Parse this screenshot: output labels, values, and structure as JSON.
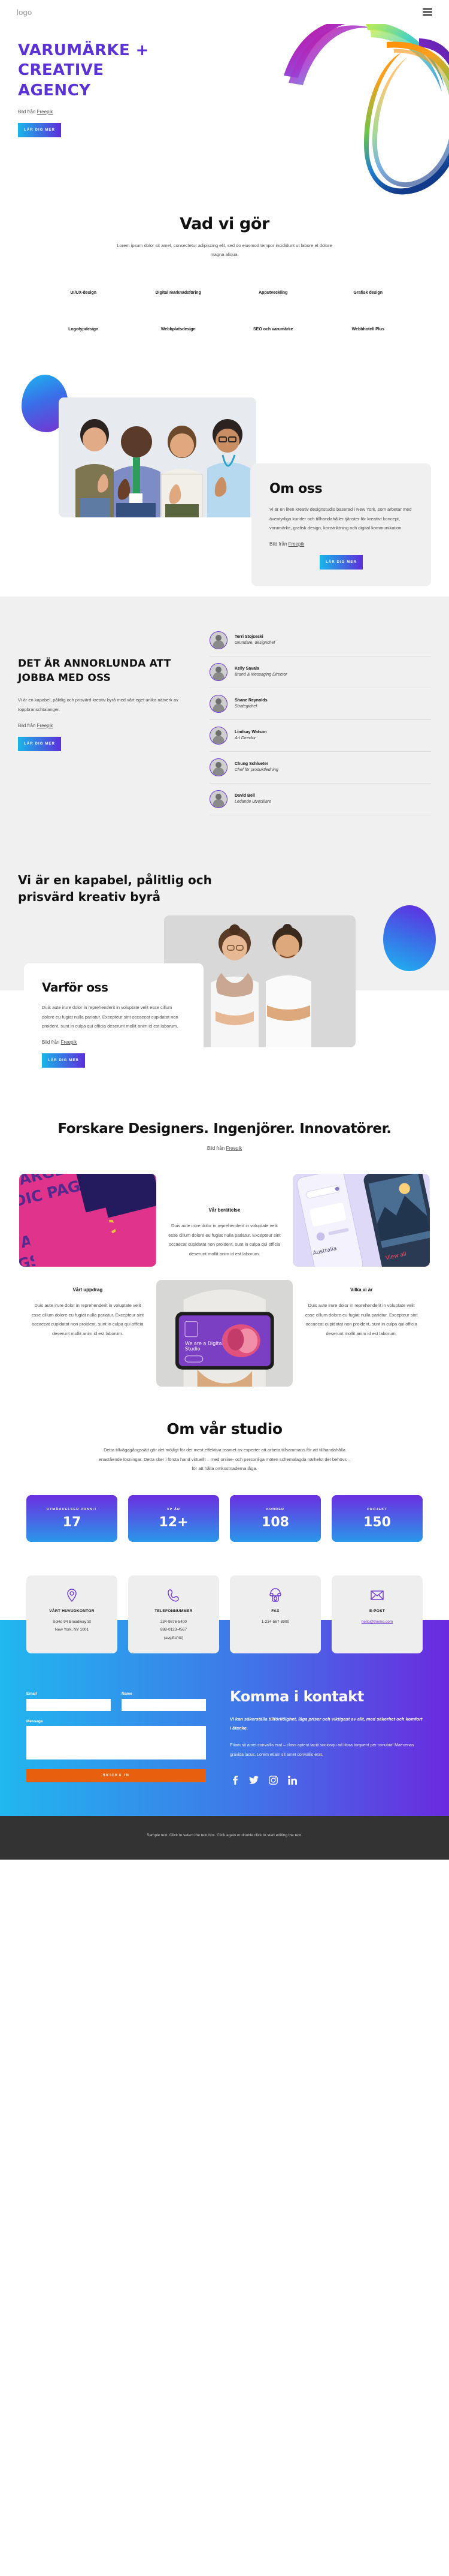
{
  "header": {
    "logo": "logo",
    "menu_icon": "hamburger-icon"
  },
  "hero": {
    "title": "VARUMÄRKE + CREATIVE AGENCY",
    "credit_prefix": "Bild från ",
    "credit_link": "Freepik",
    "cta": "LÄR DIG MER"
  },
  "services": {
    "heading": "Vad vi gör",
    "lead": "Lorem ipsum dolor sit amet, consectetur adipiscing elit, sed do eiusmod tempor incididunt ut labore et dolore magna aliqua.",
    "items": [
      "UI/UX-design",
      "Digital marknadsföring",
      "Apputveckling",
      "Grafisk design",
      "Logotypdesign",
      "Webbplatsdesign",
      "SEO och varumärke",
      "Webbhotell Plus"
    ]
  },
  "about": {
    "heading": "Om oss",
    "body": "Vi är en liten kreativ designstudio baserad i New York, som arbetar med äventyrliga kunder och tillhandahåller tjänster för kreativt koncept, varumärke, grafisk design, konstriktning och digital kommunikation.",
    "credit_prefix": "Bild från ",
    "credit_link": "Freepik",
    "cta": "LÄR DIG MER"
  },
  "team": {
    "heading": "DET ÄR ANNORLUNDA ATT JOBBA MED OSS",
    "body": "Vi är en kapabel, pålitlig och prisvärd kreativ byrå med vårt eget unika nätverk av toppbranschtalanger.",
    "credit_prefix": "Bild från ",
    "credit_link": "Freepik",
    "cta": "LÄR DIG MER",
    "members": [
      {
        "name": "Terri Stojceski",
        "role": "Grundare, designchef"
      },
      {
        "name": "Kelly Savala",
        "role": "Brand & Messaging Director"
      },
      {
        "name": "Shane Reynolds",
        "role": "Strategichef"
      },
      {
        "name": "Lindsay Watson",
        "role": "Art Director"
      },
      {
        "name": "Chung Schlueter",
        "role": "Chef för produktledning"
      },
      {
        "name": "David Bell",
        "role": "Ledande utvecklare"
      }
    ]
  },
  "why": {
    "headline": "Vi är en kapabel, pålitlig och prisvärd kreativ byrå",
    "card_heading": "Varför oss",
    "card_body": "Duis aute irure dolor in reprehenderit in voluptate velit esse cillum dolore eu fugiat nulla pariatur. Excepteur sint occaecat cupidatat non proident, sunt in culpa qui officia deserunt mollit anim id est laborum.",
    "credit_prefix": "Bild från ",
    "credit_link": "Freepik",
    "cta": "LÄR DIG MER"
  },
  "research": {
    "heading": "Forskare Designers. Ingenjörer. Innovatörer.",
    "credit_prefix": "Bild från ",
    "credit_link": "Freepik",
    "blocks": [
      {
        "title": "Vår berättelse",
        "body": "Duis aute irure dolor in reprehenderit in voluptate velit esse cillum dolore eu fugiat nulla pariatur. Excepteur sint occaecat cupidatat non proident, sunt in culpa qui officia deserunt mollit anim id est laborum."
      },
      {
        "title": "Vårt uppdrag",
        "body": "Duis aute irure dolor in reprehenderit in voluptate velit esse cillum dolore eu fugiat nulla pariatur. Excepteur sint occaecat cupidatat non proident, sunt in culpa qui officia deserunt mollit anim id est laborum."
      },
      {
        "title": "Vilka vi är",
        "body": "Duis aute irure dolor in reprehenderit in voluptate velit esse cillum dolore eu fugiat nulla pariatur. Excepteur sint occaecat cupidatat non proident, sunt in culpa qui officia deserunt mollit anim id est laborum."
      }
    ]
  },
  "stats": {
    "heading": "Om vår studio",
    "lead": "Detta tillvägagångssätt gör det möjligt för det mest effektiva teamet av experter att arbeta tillsammans för att tillhandahålla enastående lösningar. Detta sker i första hand virtuellt – med online- och personliga möten schemalagda närhelst det behövs – för att hålla omkostnaderna låga.",
    "cards": [
      {
        "label": "UTMÄRKELSER VUNNIT",
        "value": "17"
      },
      {
        "label": "XP ÅR",
        "value": "12+"
      },
      {
        "label": "KUNDER",
        "value": "108"
      },
      {
        "label": "PROJEKT",
        "value": "150"
      }
    ]
  },
  "contact_cards": [
    {
      "icon": "location-pin-icon",
      "title": "VÅRT HUVUDKONTOR",
      "line1": "SoHo 94 Broadway St",
      "line2": "New York, NY 1001",
      "line3": ""
    },
    {
      "icon": "phone-icon",
      "title": "TELEFONNUMMER",
      "line1": "234-9876-5400",
      "line2": "888-0123-4567",
      "line3": "(avgiftsfritt)"
    },
    {
      "icon": "fax-icon",
      "title": "FAX",
      "line1": "1-234-567-8900",
      "line2": "",
      "line3": ""
    },
    {
      "icon": "envelope-icon",
      "title": "E-POST",
      "line1": "hello@theme.com",
      "line2": "",
      "line3": "",
      "is_link": true
    }
  ],
  "touch": {
    "heading": "Komma i kontakt",
    "subhead": "Vi kan säkerställa tillförlitlighet, låga priser och viktigast av allt, med säkerhet och komfort i åtanke.",
    "body": "Etiam sit amet convallis erat – class aptent taciti sociosqu ad litora torquent per conubia! Maecenas gravida lacus. Lorem etiam sit amet convallis erat.",
    "form": {
      "email_label": "Email",
      "email_value": "",
      "name_label": "Name",
      "name_value": "",
      "message_label": "Message",
      "message_value": "",
      "submit": "SKICKA IN"
    },
    "socials": [
      "facebook-icon",
      "twitter-icon",
      "instagram-icon",
      "linkedin-icon"
    ]
  },
  "footer": {
    "text": "Sample text. Click to select the text box. Click again or double click to start editing the text."
  },
  "colors": {
    "purple": "#5a32d6",
    "accent_blue": "#19b5e8",
    "orange": "#e8600d",
    "grey_bg": "#f0f0f0",
    "footer_bg": "#333333"
  }
}
